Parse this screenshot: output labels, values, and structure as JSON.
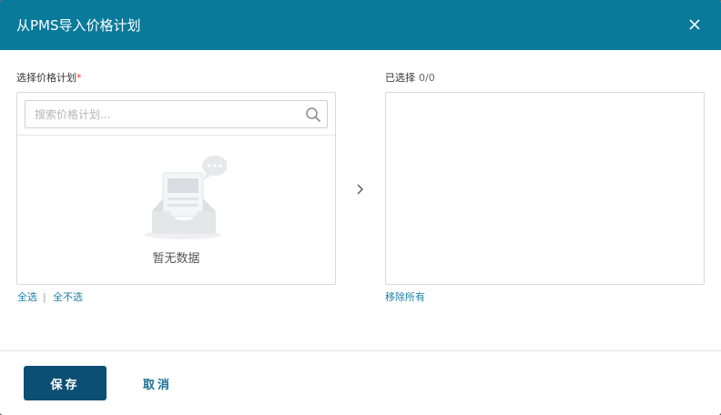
{
  "dialog": {
    "title": "从PMS导入价格计划",
    "close_icon": "close-icon"
  },
  "left_panel": {
    "label": "选择价格计划",
    "required_mark": "*",
    "search": {
      "placeholder": "搜索价格计划...",
      "value": "",
      "icon": "search-icon"
    },
    "empty": {
      "icon": "empty-inbox-icon",
      "text": "暂无数据"
    },
    "select_all": "全选",
    "separator": "|",
    "deselect_all": "全不选"
  },
  "transfer": {
    "icon": "chevron-right-icon"
  },
  "right_panel": {
    "label": "已选择",
    "count": "0/0",
    "remove_all": "移除所有"
  },
  "footer": {
    "save_label": "保存",
    "cancel_label": "取消"
  },
  "colors": {
    "header_bg": "#0a7a9b",
    "primary_button": "#0d4e73",
    "link": "#1a7fa8",
    "required": "#e23b3b"
  }
}
